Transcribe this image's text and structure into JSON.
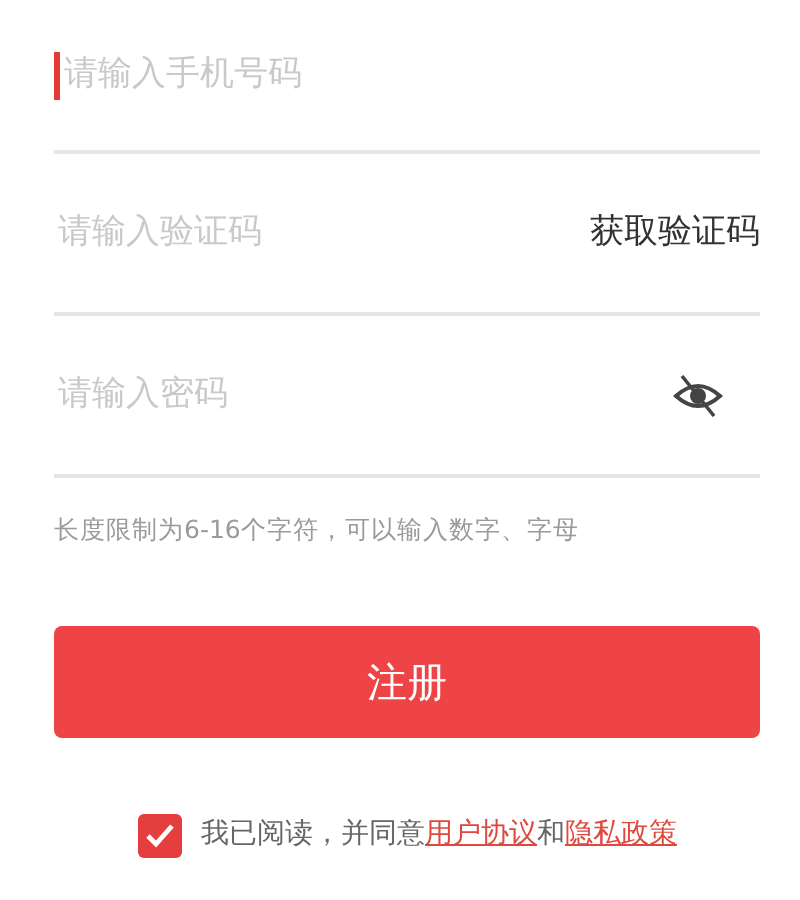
{
  "fields": [
    {
      "kind": "phone",
      "placeholder": "请输入手机号码",
      "focused": true
    },
    {
      "kind": "code",
      "placeholder": "请输入验证码",
      "focused": false,
      "action": "获取验证码"
    },
    {
      "kind": "password",
      "placeholder": "请输入密码",
      "focused": false,
      "password_visible": false
    }
  ],
  "hint": "长度限制为6-16个字符，可以输入数字、字母",
  "submit_button": "注册",
  "agreement": {
    "checked": true,
    "parts": [
      {
        "kind": "text",
        "text": "我已阅读，并同意"
      },
      {
        "kind": "link",
        "text": "用户协议"
      },
      {
        "kind": "text",
        "text": "和"
      },
      {
        "kind": "link",
        "text": "隐私政策"
      }
    ]
  }
}
